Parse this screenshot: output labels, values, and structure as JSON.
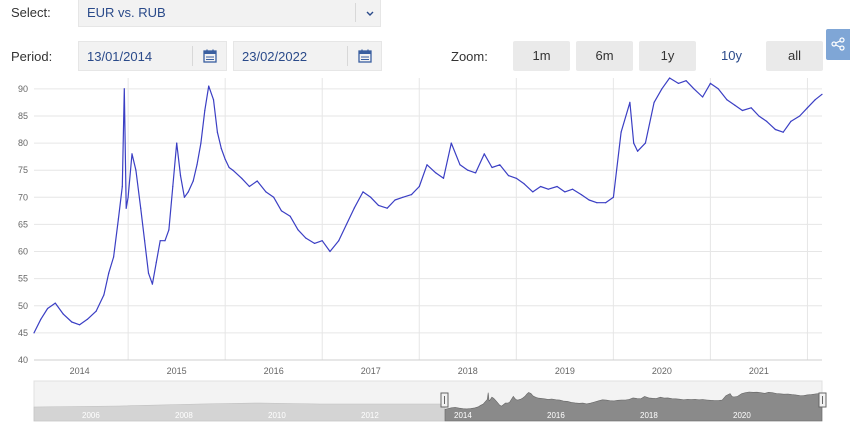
{
  "controls": {
    "select_label": "Select:",
    "select_value": "EUR vs. RUB",
    "period_label": "Period:",
    "date_from": "13/01/2014",
    "date_to": "23/02/2022",
    "zoom_label": "Zoom:",
    "zoom_options": [
      "1m",
      "6m",
      "1y",
      "10y",
      "all"
    ],
    "zoom_selected": "10y"
  },
  "colors": {
    "line": "#3b3fc4",
    "grid": "#e6e6e6",
    "accent": "#2a4a8a",
    "share_button": "#7fa6d6",
    "navigator_fill": "#8a8a8a"
  },
  "icons": {
    "select_toggle": "chevron-down-icon",
    "date_picker": "calendar-icon",
    "share": "share-icon"
  },
  "chart_data": {
    "type": "line",
    "title": "",
    "xlabel": "",
    "ylabel": "",
    "xlim": [
      2014.03,
      2022.15
    ],
    "ylim": [
      40,
      92
    ],
    "yticks": [
      40,
      45,
      50,
      55,
      60,
      65,
      70,
      75,
      80,
      85,
      90
    ],
    "xticks": [
      "2014",
      "2015",
      "2016",
      "2017",
      "2018",
      "2019",
      "2020",
      "2021"
    ],
    "grid": true,
    "series": [
      {
        "name": "",
        "x": [
          2014.03,
          2014.1,
          2014.17,
          2014.25,
          2014.33,
          2014.42,
          2014.5,
          2014.58,
          2014.67,
          2014.75,
          2014.8,
          2014.85,
          2014.9,
          2014.94,
          2014.96,
          2014.98,
          2015.0,
          2015.04,
          2015.08,
          2015.13,
          2015.17,
          2015.21,
          2015.25,
          2015.29,
          2015.33,
          2015.38,
          2015.42,
          2015.46,
          2015.5,
          2015.54,
          2015.58,
          2015.62,
          2015.67,
          2015.71,
          2015.75,
          2015.79,
          2015.83,
          2015.88,
          2015.92,
          2015.96,
          2016.0,
          2016.04,
          2016.08,
          2016.17,
          2016.25,
          2016.33,
          2016.42,
          2016.5,
          2016.58,
          2016.67,
          2016.75,
          2016.83,
          2016.92,
          2017.0,
          2017.08,
          2017.17,
          2017.25,
          2017.33,
          2017.42,
          2017.5,
          2017.58,
          2017.67,
          2017.75,
          2017.83,
          2017.92,
          2018.0,
          2018.08,
          2018.17,
          2018.25,
          2018.33,
          2018.42,
          2018.5,
          2018.58,
          2018.67,
          2018.75,
          2018.83,
          2018.92,
          2019.0,
          2019.08,
          2019.17,
          2019.25,
          2019.33,
          2019.42,
          2019.5,
          2019.58,
          2019.67,
          2019.75,
          2019.83,
          2019.92,
          2020.0,
          2020.08,
          2020.17,
          2020.21,
          2020.25,
          2020.33,
          2020.42,
          2020.5,
          2020.58,
          2020.67,
          2020.75,
          2020.83,
          2020.92,
          2021.0,
          2021.08,
          2021.17,
          2021.25,
          2021.33,
          2021.42,
          2021.5,
          2021.58,
          2021.67,
          2021.75,
          2021.83,
          2021.92,
          2022.0,
          2022.08,
          2022.15
        ],
        "y": [
          45.0,
          47.5,
          49.5,
          50.5,
          48.5,
          47.0,
          46.5,
          47.5,
          49.0,
          52.0,
          56.0,
          59.0,
          66.0,
          72.0,
          90.0,
          68.0,
          70.0,
          78.0,
          75.0,
          68.0,
          62.0,
          56.0,
          54.0,
          58.0,
          62.0,
          62.0,
          64.0,
          72.0,
          80.0,
          74.0,
          70.0,
          71.0,
          73.0,
          76.0,
          80.0,
          86.0,
          90.5,
          88.0,
          82.0,
          79.0,
          77.0,
          75.5,
          75.0,
          73.5,
          72.0,
          73.0,
          71.0,
          70.0,
          67.5,
          66.5,
          64.0,
          62.5,
          61.5,
          62.0,
          60.0,
          62.0,
          65.0,
          68.0,
          71.0,
          70.0,
          68.5,
          68.0,
          69.5,
          70.0,
          70.5,
          72.0,
          76.0,
          74.5,
          73.5,
          80.0,
          76.0,
          75.0,
          74.5,
          78.0,
          75.5,
          76.0,
          74.0,
          73.5,
          72.5,
          71.0,
          72.0,
          71.5,
          72.0,
          71.0,
          71.5,
          70.5,
          69.5,
          69.0,
          69.0,
          70.0,
          82.0,
          87.5,
          80.0,
          78.5,
          80.0,
          87.5,
          90.0,
          92.0,
          91.0,
          91.5,
          90.0,
          88.5,
          91.0,
          90.0,
          88.0,
          87.0,
          86.0,
          86.5,
          85.0,
          84.0,
          82.5,
          82.0,
          84.0,
          85.0,
          86.5,
          88.0,
          89.0
        ]
      }
    ],
    "navigator": {
      "x_labels": [
        "2006",
        "2008",
        "2010",
        "2012",
        "2014",
        "2016",
        "2018",
        "2020"
      ]
    }
  }
}
